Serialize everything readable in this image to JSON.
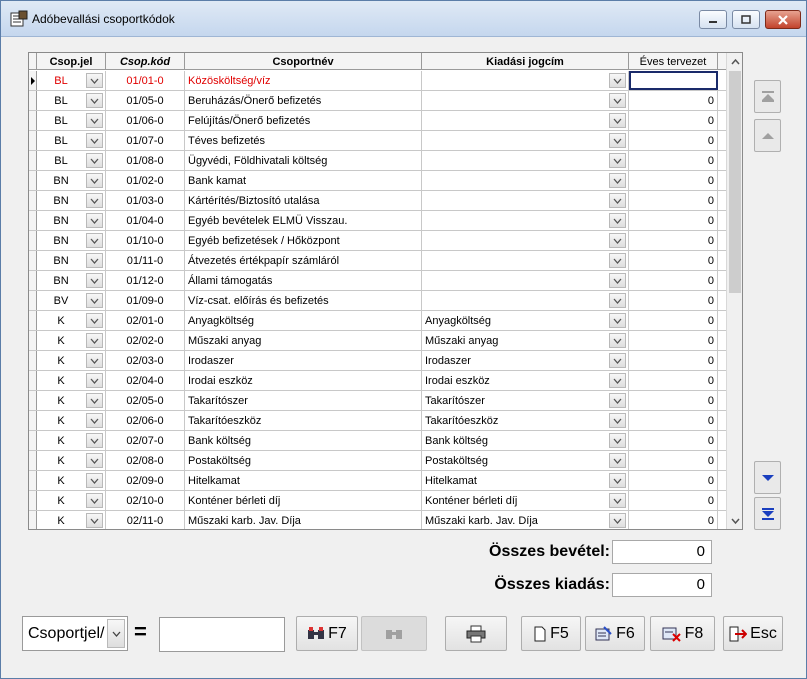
{
  "window": {
    "title": "Adóbevallási csoportkódok",
    "minimize": "–",
    "maximize": "□",
    "close": "✕"
  },
  "grid": {
    "columns": [
      "Csop.jel",
      "Csop.kód",
      "Csoportnév",
      "Kiadási jogcím",
      "Éves tervezet"
    ],
    "current_row": 0,
    "rows": [
      {
        "jel": "BL",
        "kod": "01/01-0",
        "nev": "Közösköltség/víz",
        "jogcim": "",
        "eves": ""
      },
      {
        "jel": "BL",
        "kod": "01/05-0",
        "nev": "Beruházás/Önerő befizetés",
        "jogcim": "",
        "eves": "0"
      },
      {
        "jel": "BL",
        "kod": "01/06-0",
        "nev": "Felújítás/Önerő befizetés",
        "jogcim": "",
        "eves": "0"
      },
      {
        "jel": "BL",
        "kod": "01/07-0",
        "nev": "Téves befizetés",
        "jogcim": "",
        "eves": "0"
      },
      {
        "jel": "BL",
        "kod": "01/08-0",
        "nev": "Ügyvédi, Földhivatali költség",
        "jogcim": "",
        "eves": "0"
      },
      {
        "jel": "BN",
        "kod": "01/02-0",
        "nev": "Bank kamat",
        "jogcim": "",
        "eves": "0"
      },
      {
        "jel": "BN",
        "kod": "01/03-0",
        "nev": "Kártérítés/Biztosító utalása",
        "jogcim": "",
        "eves": "0"
      },
      {
        "jel": "BN",
        "kod": "01/04-0",
        "nev": "Egyéb bevételek  ELMÜ Visszau.",
        "jogcim": "",
        "eves": "0"
      },
      {
        "jel": "BN",
        "kod": "01/10-0",
        "nev": "Egyéb befizetések / Hőközpont",
        "jogcim": "",
        "eves": "0"
      },
      {
        "jel": "BN",
        "kod": "01/11-0",
        "nev": "Átvezetés értékpapír számláról",
        "jogcim": "",
        "eves": "0"
      },
      {
        "jel": "BN",
        "kod": "01/12-0",
        "nev": "Állami támogatás",
        "jogcim": "",
        "eves": "0"
      },
      {
        "jel": "BV",
        "kod": "01/09-0",
        "nev": "Víz-csat. előírás és befizetés",
        "jogcim": "",
        "eves": "0"
      },
      {
        "jel": "K",
        "kod": "02/01-0",
        "nev": "Anyagköltség",
        "jogcim": "Anyagköltség",
        "eves": "0"
      },
      {
        "jel": "K",
        "kod": "02/02-0",
        "nev": "Műszaki anyag",
        "jogcim": "Műszaki anyag",
        "eves": "0"
      },
      {
        "jel": "K",
        "kod": "02/03-0",
        "nev": "Irodaszer",
        "jogcim": "Irodaszer",
        "eves": "0"
      },
      {
        "jel": "K",
        "kod": "02/04-0",
        "nev": "Irodai eszköz",
        "jogcim": "Irodai eszköz",
        "eves": "0"
      },
      {
        "jel": "K",
        "kod": "02/05-0",
        "nev": "Takarítószer",
        "jogcim": "Takarítószer",
        "eves": "0"
      },
      {
        "jel": "K",
        "kod": "02/06-0",
        "nev": "Takarítóeszköz",
        "jogcim": "Takarítóeszköz",
        "eves": "0"
      },
      {
        "jel": "K",
        "kod": "02/07-0",
        "nev": "Bank költség",
        "jogcim": "Bank költség",
        "eves": "0"
      },
      {
        "jel": "K",
        "kod": "02/08-0",
        "nev": "Postaköltség",
        "jogcim": "Postaköltség",
        "eves": "0"
      },
      {
        "jel": "K",
        "kod": "02/09-0",
        "nev": "Hitelkamat",
        "jogcim": "Hitelkamat",
        "eves": "0"
      },
      {
        "jel": "K",
        "kod": "02/10-0",
        "nev": "Konténer bérleti díj",
        "jogcim": "Konténer bérleti díj",
        "eves": "0"
      },
      {
        "jel": "K",
        "kod": "02/11-0",
        "nev": "Műszaki karb. Jav. Díja",
        "jogcim": "Műszaki karb. Jav. Díja",
        "eves": "0"
      }
    ]
  },
  "totals": {
    "bevetel_label": "Összes bevétel:",
    "bevetel_value": "0",
    "kiadas_label": "Összes kiadás:",
    "kiadas_value": "0"
  },
  "toolbar": {
    "combo_value": "Csoportjel/",
    "equals": "=",
    "search_value": "",
    "f7_label": "F7",
    "f5_label": "F5",
    "f6_label": "F6",
    "f8_label": "F8",
    "esc_label": "Esc"
  },
  "colors": {
    "current_row_text": "#e00000",
    "nav_arrow_active": "#1a3fbf",
    "nav_arrow_disabled": "#a0a0a0"
  }
}
